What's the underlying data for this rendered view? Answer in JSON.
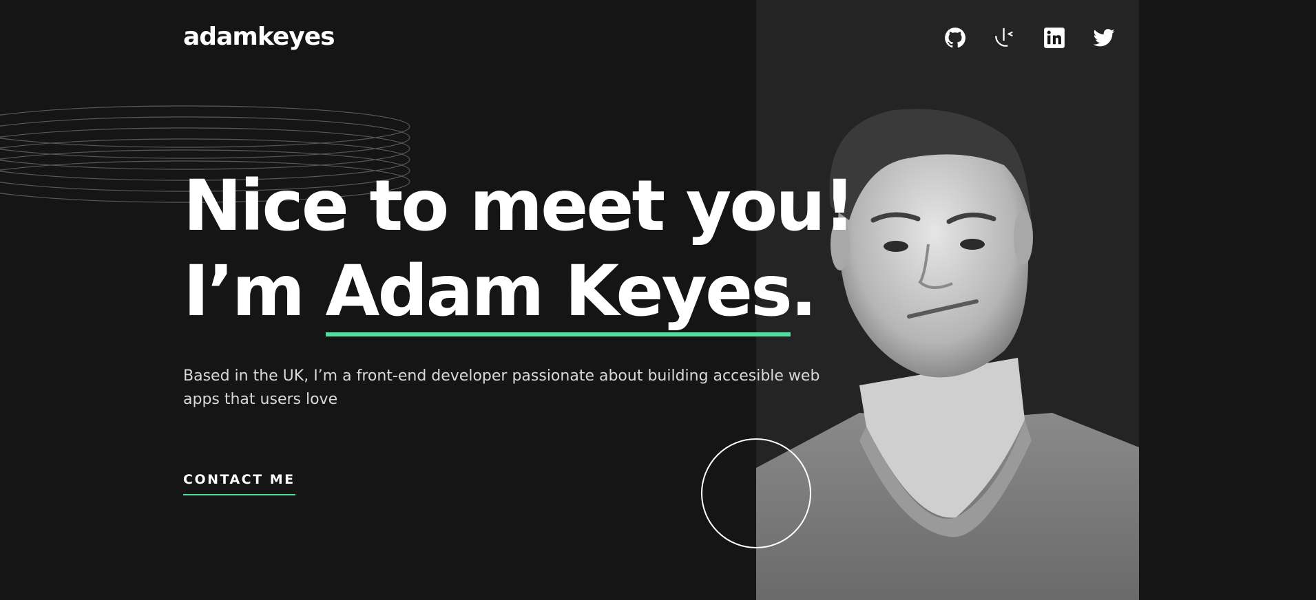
{
  "header": {
    "logo": "adamkeyes",
    "socials": [
      {
        "icon": "github-icon"
      },
      {
        "icon": "frontend-mentor-icon"
      },
      {
        "icon": "linkedin-icon"
      },
      {
        "icon": "twitter-icon"
      }
    ]
  },
  "hero": {
    "line1": "Nice to meet you!",
    "line2_prefix": "I’m ",
    "name": "Adam Keyes",
    "line2_suffix": ".",
    "tagline": "Based in the UK, I’m a front-end developer passionate about building accesible web apps that users love",
    "contact_label": "CONTACT ME"
  },
  "colors": {
    "background": "#151515",
    "panel": "#242424",
    "accent": "#4ee1a0",
    "text": "#ffffff"
  }
}
